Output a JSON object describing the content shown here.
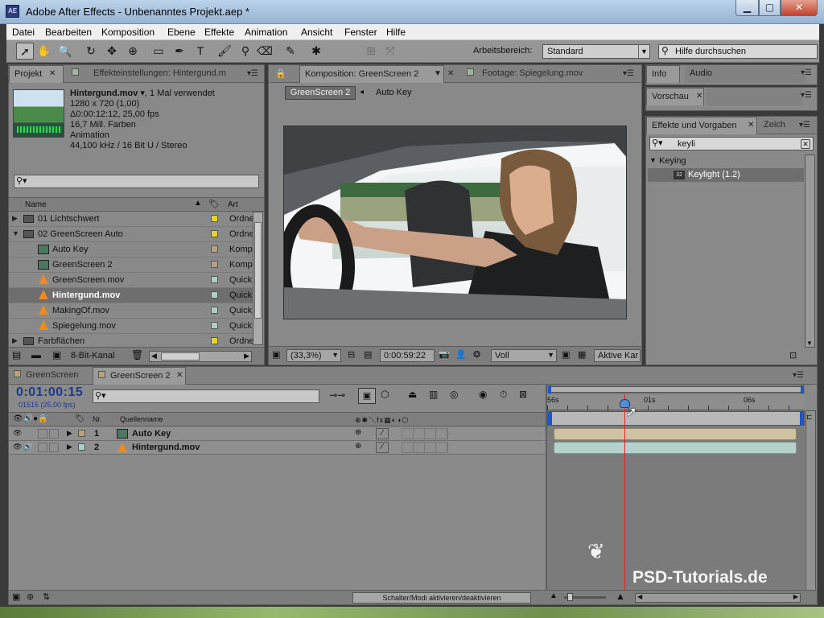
{
  "window": {
    "title": "Adobe After Effects - Unbenanntes Projekt.aep *",
    "app_icon": "AE"
  },
  "menu": [
    "Datei",
    "Bearbeiten",
    "Komposition",
    "Ebene",
    "Effekte",
    "Animation",
    "Ansicht",
    "Fenster",
    "Hilfe"
  ],
  "toolbar": {
    "workspace_label": "Arbeitsbereich:",
    "workspace_value": "Standard",
    "help_search": "Hilfe durchsuchen"
  },
  "project": {
    "tab": "Projekt",
    "tab2": "Effekteinstellungen: Hintergund.m",
    "footage": {
      "name": "Hintergund.mov ▾",
      "usage": ", 1 Mal verwendet",
      "lines": [
        "1280 x 720 (1,00)",
        "Δ0:00:12:12, 25,00 fps",
        "16,7 Mill. Farben",
        "Animation",
        "44,100 kHz / 16 Bit U / Stereo"
      ]
    },
    "col_name": "Name",
    "col_type": "Art",
    "items": [
      {
        "name": "01 Lichtschwert",
        "type": "Ordne"
      },
      {
        "name": "02 GreenScreen Auto",
        "type": "Ordne"
      },
      {
        "name": "Auto Key",
        "type": "Komp"
      },
      {
        "name": "GreenScreen 2",
        "type": "Komp"
      },
      {
        "name": "GreenScreen.mov",
        "type": "Quick"
      },
      {
        "name": "Hintergund.mov",
        "type": "Quick"
      },
      {
        "name": "MakingOf.mov",
        "type": "Quick"
      },
      {
        "name": "Spiegelung.mov",
        "type": "Quick"
      },
      {
        "name": "Farbflächen",
        "type": "Ordne"
      }
    ],
    "bit_depth": "8-Bit-Kanal"
  },
  "composition": {
    "tab": "Komposition: GreenScreen 2",
    "tab_footage": "Footage: Spiegelung.mov",
    "breadcrumb_active": "GreenScreen 2",
    "breadcrumb_next": "Auto Key",
    "zoom": "(33,3%)",
    "timecode": "0:00:59:22",
    "resolution": "Voll",
    "camera": "Aktive Kar"
  },
  "right": {
    "tab_info": "Info",
    "tab_audio": "Audio",
    "tab_preview": "Vorschau",
    "tab_effects": "Effekte und Vorgaben",
    "tab_char": "Zeich",
    "search_value": "keyli",
    "category": "Keying",
    "effect": "Keylight (1.2)",
    "effect_badge": "32"
  },
  "timeline": {
    "tab1": "GreenScreen",
    "tab2": "GreenScreen 2",
    "timecode": "0:01:00:15",
    "frames": "01515 (25.00 fps)",
    "col_nr": "Nr.",
    "col_source": "Quellenname",
    "ruler_labels": [
      "56s",
      "01s",
      "06s"
    ],
    "layers": [
      {
        "nr": "1",
        "name": "Auto Key"
      },
      {
        "nr": "2",
        "name": "Hintergund.mov"
      }
    ],
    "switch_toggle": "Schalter/Modi aktivieren/deaktivieren"
  },
  "watermark": "PSD-Tutorials.de",
  "colors": {
    "label_yellow": "#e3d23a",
    "label_tan": "#b6a37e",
    "label_teal": "#a9cfc7",
    "playhead": "#e0241c",
    "timecode_blue": "#1d3a8a"
  }
}
